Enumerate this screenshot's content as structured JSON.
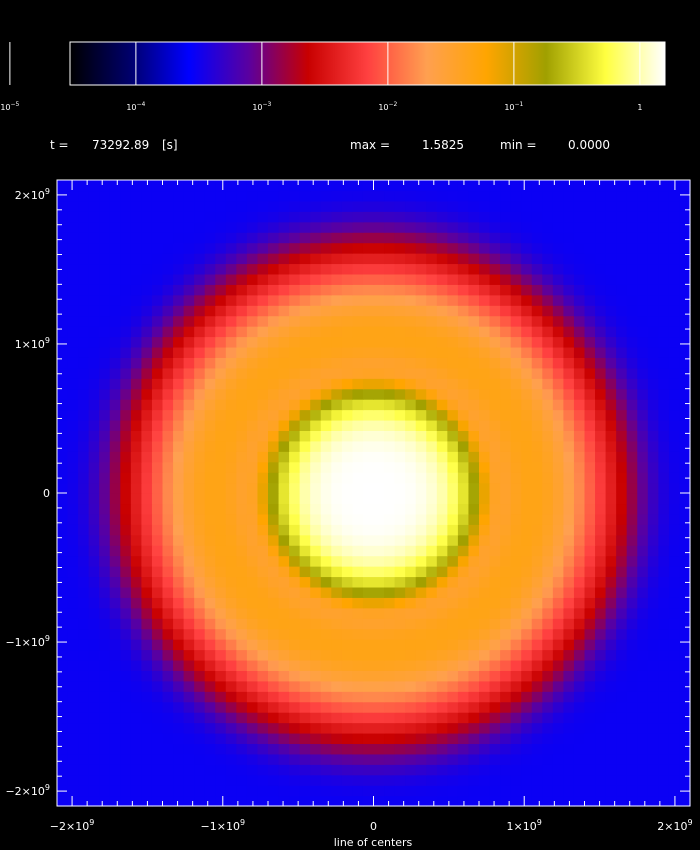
{
  "info": {
    "time_label": "t =",
    "time_value": "73292.89",
    "time_unit": "[s]",
    "max_label": "max =",
    "max_value": "1.5825",
    "min_label": "min =",
    "min_value": "0.0000"
  },
  "chart_data": {
    "type": "heatmap",
    "title": "",
    "xlabel": "line of centers",
    "ylabel": "",
    "xlim": [
      -2100000000.0,
      2100000000.0
    ],
    "ylim": [
      -2100000000.0,
      2100000000.0
    ],
    "x_ticks": [
      {
        "value": -2000000000.0,
        "base": "−2×10",
        "exp": "9"
      },
      {
        "value": -1000000000.0,
        "base": "−1×10",
        "exp": "9"
      },
      {
        "value": 0,
        "base": "0",
        "exp": ""
      },
      {
        "value": 1000000000.0,
        "base": "1×10",
        "exp": "9"
      },
      {
        "value": 2000000000.0,
        "base": "2×10",
        "exp": "9"
      }
    ],
    "y_ticks": [
      {
        "value": 2000000000.0,
        "base": "2×10",
        "exp": "9"
      },
      {
        "value": 1000000000.0,
        "base": "1×10",
        "exp": "9"
      },
      {
        "value": 0,
        "base": "0",
        "exp": ""
      },
      {
        "value": -1000000000.0,
        "base": "−1×10",
        "exp": "9"
      },
      {
        "value": -2000000000.0,
        "base": "−2×10",
        "exp": "9"
      }
    ],
    "colorbar": {
      "scale": "log",
      "range": [
        3e-05,
        1.5825
      ],
      "ticks": [
        {
          "value": 1e-05,
          "base": "10",
          "exp": "−5"
        },
        {
          "value": 0.0001,
          "base": "10",
          "exp": "−4"
        },
        {
          "value": 0.001,
          "base": "10",
          "exp": "−3"
        },
        {
          "value": 0.01,
          "base": "10",
          "exp": "−2"
        },
        {
          "value": 0.1,
          "base": "10",
          "exp": "−1"
        },
        {
          "value": 1,
          "base": "1",
          "exp": ""
        }
      ],
      "colors": [
        "#000000",
        "#00006a",
        "#0000ff",
        "#5a00a0",
        "#c80000",
        "#ff4040",
        "#ffa050",
        "#ffa500",
        "#a0a000",
        "#ffff40",
        "#ffffff"
      ]
    },
    "field": {
      "grid": 60,
      "description_radius_max": 1580000000.0,
      "background_value": 0.0003
    }
  },
  "colors": {
    "background": "#000000",
    "foreground": "#ffffff"
  }
}
